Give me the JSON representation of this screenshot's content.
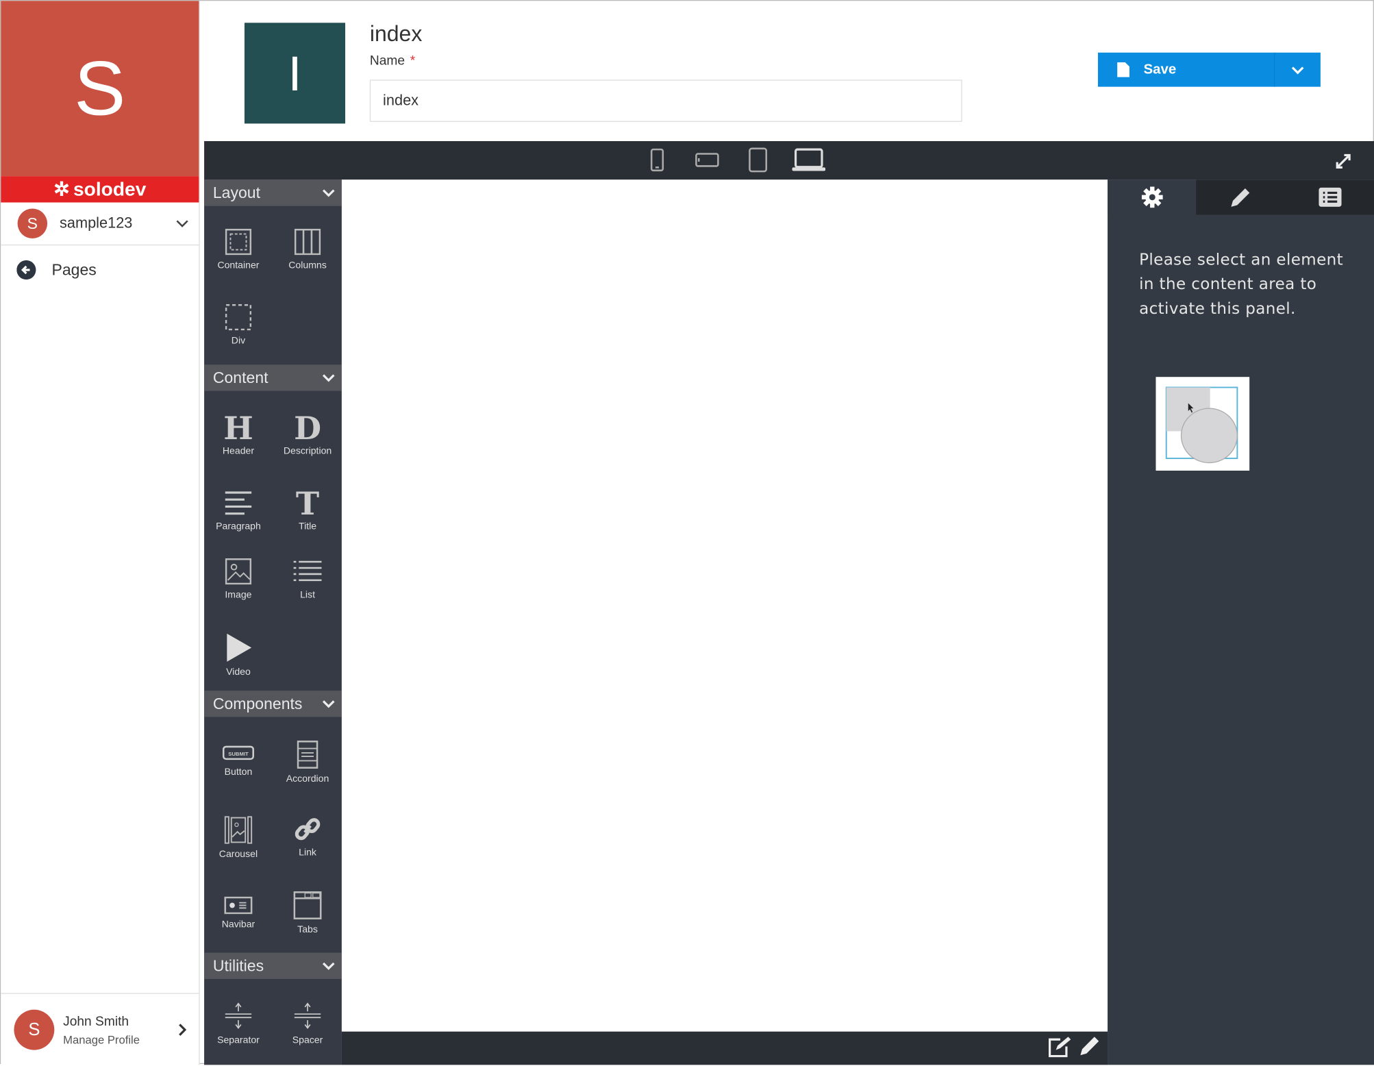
{
  "sidebar": {
    "site_initial": "S",
    "brand": "solodev",
    "account": {
      "initial": "S",
      "name": "sample123"
    },
    "nav": {
      "pages_label": "Pages"
    },
    "profile": {
      "initial": "S",
      "name": "John Smith",
      "link": "Manage Profile"
    }
  },
  "header": {
    "page_initial": "I",
    "title": "index",
    "name_label": "Name",
    "required_mark": "*",
    "name_value": "index",
    "save_label": "Save"
  },
  "toolbar": {
    "devices": [
      "mobile-portrait",
      "mobile-landscape",
      "tablet",
      "desktop"
    ]
  },
  "builder": {
    "sections": [
      {
        "title": "Layout",
        "items": [
          "Container",
          "Columns",
          "Div"
        ]
      },
      {
        "title": "Content",
        "items": [
          "Header",
          "Description",
          "Paragraph",
          "Title",
          "Image",
          "List",
          "Video"
        ]
      },
      {
        "title": "Components",
        "items": [
          "Button",
          "Accordion",
          "Carousel",
          "Link",
          "Navibar",
          "Tabs"
        ]
      },
      {
        "title": "Utilities",
        "items": [
          "Separator",
          "Spacer"
        ]
      }
    ],
    "button_icon_text": "SUBMIT"
  },
  "right_panel": {
    "tabs": [
      "settings",
      "style",
      "layers"
    ],
    "message": "Please select an element in the content area to activate this panel."
  },
  "colors": {
    "brand_red": "#e42424",
    "site_tile": "#c95142",
    "page_tile": "#234e52",
    "save_blue": "#0a8de0",
    "panel_dark": "#353a44"
  }
}
